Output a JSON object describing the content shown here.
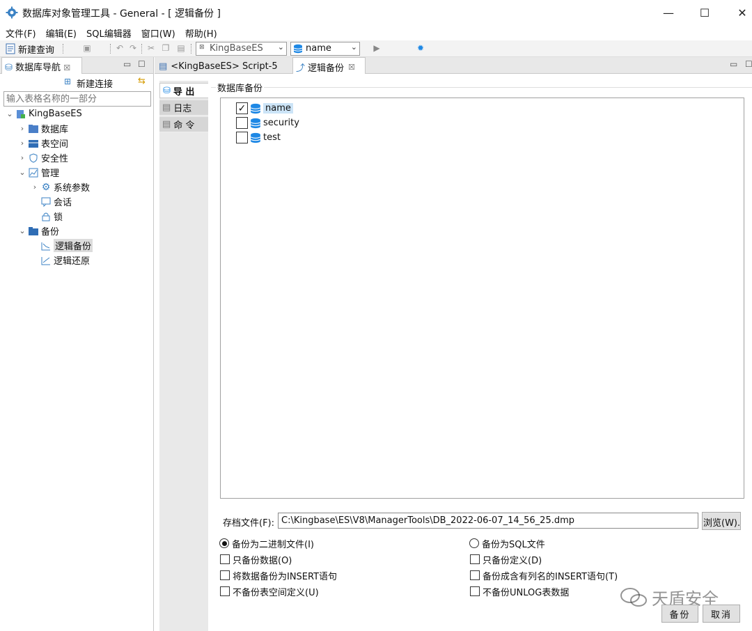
{
  "window": {
    "title": "数据库对象管理工具 - General - [ 逻辑备份 ]",
    "minimize": "—",
    "maximize": "☐",
    "close": "✕"
  },
  "menu": [
    "文件(F)",
    "编辑(E)",
    "SQL编辑器",
    "窗口(W)",
    "帮助(H)"
  ],
  "toolbar": {
    "new_query": "新建查询",
    "connection_combo": "KingBaseES",
    "database_combo": "name"
  },
  "navigator": {
    "tab_label": "数据库导航",
    "new_connection": "新建连接",
    "filter_placeholder": "输入表格名称的一部分",
    "tree": {
      "root": "KingBaseES",
      "database": "数据库",
      "tablespace": "表空间",
      "security": "安全性",
      "management": "管理",
      "sys_params": "系统参数",
      "session": "会话",
      "lock": "锁",
      "backup": "备份",
      "logical_backup": "逻辑备份",
      "logical_restore": "逻辑还原"
    }
  },
  "editor_tabs": {
    "script": "<KingBaseES> Script-5",
    "backup": "逻辑备份"
  },
  "side_tabs": {
    "export": "导 出",
    "log": "日志",
    "command": "命 令"
  },
  "backup": {
    "group_title": "数据库备份",
    "databases": [
      {
        "name": "name",
        "checked": true
      },
      {
        "name": "security",
        "checked": false
      },
      {
        "name": "test",
        "checked": false
      }
    ],
    "file_label": "存档文件(F):",
    "file_path": "C:\\Kingbase\\ES\\V8\\ManagerTools\\DB_2022-06-07_14_56_25.dmp",
    "browse_button": "浏览(W)...",
    "radio_binary": "备份为二进制文件(I)",
    "radio_sql": "备份为SQL文件",
    "only_data": "只备份数据(O)",
    "only_definition": "只备份定义(D)",
    "as_insert": "将数据备份为INSERT语句",
    "insert_with_columns": "备份成含有列名的INSERT语句(T)",
    "no_tablespace": "不备份表空间定义(U)",
    "no_unlog": "不备份UNLOG表数据",
    "backup_button": "备份",
    "cancel_button": "取消"
  },
  "watermark": "天盾安全"
}
